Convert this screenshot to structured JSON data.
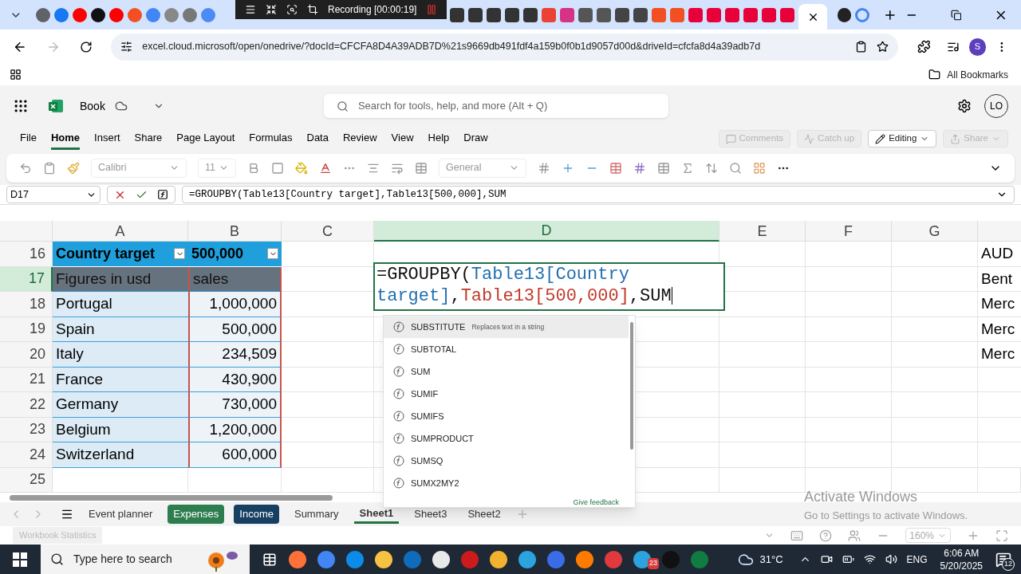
{
  "recording_bar": {
    "text": "Recording [00:00:19]"
  },
  "browser": {
    "url": "excel.cloud.microsoft/open/onedrive/?docId=CFCFA8D4A39ADB7D%21s9669db491fdf4a159b0f0b1d9057d00d&driveId=cfcfa8d4a39adb7d",
    "profile": "S",
    "bookmarks": "All Bookmarks"
  },
  "app": {
    "file_name": "Book",
    "search": {
      "placeholder": "Search for tools, help, and more (Alt + Q)"
    },
    "user": "LO"
  },
  "menu_tabs": [
    {
      "label": "File",
      "selected": false
    },
    {
      "label": "Home",
      "selected": true
    },
    {
      "label": "Insert",
      "selected": false
    },
    {
      "label": "Share",
      "selected": false
    },
    {
      "label": "Page Layout",
      "selected": false
    },
    {
      "label": "Formulas",
      "selected": false
    },
    {
      "label": "Data",
      "selected": false
    },
    {
      "label": "Review",
      "selected": false
    },
    {
      "label": "View",
      "selected": false
    },
    {
      "label": "Help",
      "selected": false
    },
    {
      "label": "Draw",
      "selected": false
    }
  ],
  "header_buttons": [
    {
      "kind": "comments",
      "label": "Comments",
      "disabled": true
    },
    {
      "kind": "catchup",
      "label": "Catch up",
      "disabled": true
    },
    {
      "kind": "editing",
      "label": "Editing",
      "disabled": false
    },
    {
      "kind": "share",
      "label": "Share",
      "disabled": true
    }
  ],
  "ribbon": {
    "font": "Calibri",
    "size": "11",
    "number_format": "General"
  },
  "formula_bar": {
    "name_box": "D17",
    "formula": "=GROUPBY(Table13[Country target],Table13[500,000],SUM"
  },
  "columns": [
    {
      "label": "A",
      "selected": false
    },
    {
      "label": "B",
      "selected": false
    },
    {
      "label": "C",
      "selected": false
    },
    {
      "label": "D",
      "selected": true
    },
    {
      "label": "E",
      "selected": false
    },
    {
      "label": "F",
      "selected": false
    },
    {
      "label": "G",
      "selected": false
    }
  ],
  "rows": [
    {
      "number": "16",
      "selected": false,
      "kind": "header",
      "a": "Country target",
      "b": "500,000",
      "h": "AUD"
    },
    {
      "number": "17",
      "selected": true,
      "kind": "subheader",
      "a": "Figures in usd",
      "b": "sales",
      "h": "Bent"
    },
    {
      "number": "18",
      "selected": false,
      "kind": "data",
      "a": "Portugal",
      "b": "1,000,000",
      "h": "Merc"
    },
    {
      "number": "19",
      "selected": false,
      "kind": "data",
      "a": "Spain",
      "b": "500,000",
      "h": "Merc"
    },
    {
      "number": "20",
      "selected": false,
      "kind": "data",
      "a": "Italy",
      "b": "234,509",
      "h": "Merc"
    },
    {
      "number": "21",
      "selected": false,
      "kind": "data",
      "a": "France",
      "b": "430,900"
    },
    {
      "number": "22",
      "selected": false,
      "kind": "data",
      "a": "Germany",
      "b": "730,000"
    },
    {
      "number": "23",
      "selected": false,
      "kind": "data",
      "a": "Belgium",
      "b": "1,200,000"
    },
    {
      "number": "24",
      "selected": false,
      "kind": "data",
      "a": "Switzerland",
      "b": "600,000"
    },
    {
      "number": "25",
      "selected": false,
      "kind": "empty"
    }
  ],
  "cell_editor": {
    "parts": [
      {
        "kind": "plain",
        "text": "=GROUPBY("
      },
      {
        "kind": "ref1",
        "text": "Table13[Country target]"
      },
      {
        "kind": "plain",
        "text": ","
      },
      {
        "kind": "ref2",
        "text": "Table13[500,000]"
      },
      {
        "kind": "plain",
        "text": ",SUM"
      }
    ]
  },
  "autocomplete": {
    "items": [
      {
        "name": "SUBSTITUTE",
        "description": "Replaces text in a string",
        "selected": true
      },
      {
        "name": "SUBTOTAL",
        "selected": false
      },
      {
        "name": "SUM",
        "selected": false
      },
      {
        "name": "SUMIF",
        "selected": false
      },
      {
        "name": "SUMIFS",
        "selected": false
      },
      {
        "name": "SUMPRODUCT",
        "selected": false
      },
      {
        "name": "SUMSQ",
        "selected": false
      },
      {
        "name": "SUMX2MY2",
        "selected": false
      }
    ],
    "feedback": "Give feedback"
  },
  "sheet_tabs": [
    {
      "label": "Event planner",
      "selected": false
    },
    {
      "label": "Expenses",
      "selected": false,
      "color": "#2e7d4f"
    },
    {
      "label": "Income",
      "selected": false,
      "color": "#173f62"
    },
    {
      "label": "Summary",
      "selected": false
    },
    {
      "label": "Sheet1",
      "selected": true
    },
    {
      "label": "Sheet3",
      "selected": false
    },
    {
      "label": "Sheet2",
      "selected": false
    }
  ],
  "status_bar": {
    "workbook_statistics": "Workbook Statistics",
    "zoom": "160%"
  },
  "activation": {
    "title": "Activate Windows",
    "subtitle": "Go to Settings to activate Windows."
  },
  "taskbar": {
    "search": {
      "placeholder": "Type here to search"
    },
    "telegram_badge": "23",
    "temperature": "31°C",
    "language": "ENG",
    "time": "6:06 AM",
    "date": "5/20/2025",
    "notifications": "12"
  }
}
